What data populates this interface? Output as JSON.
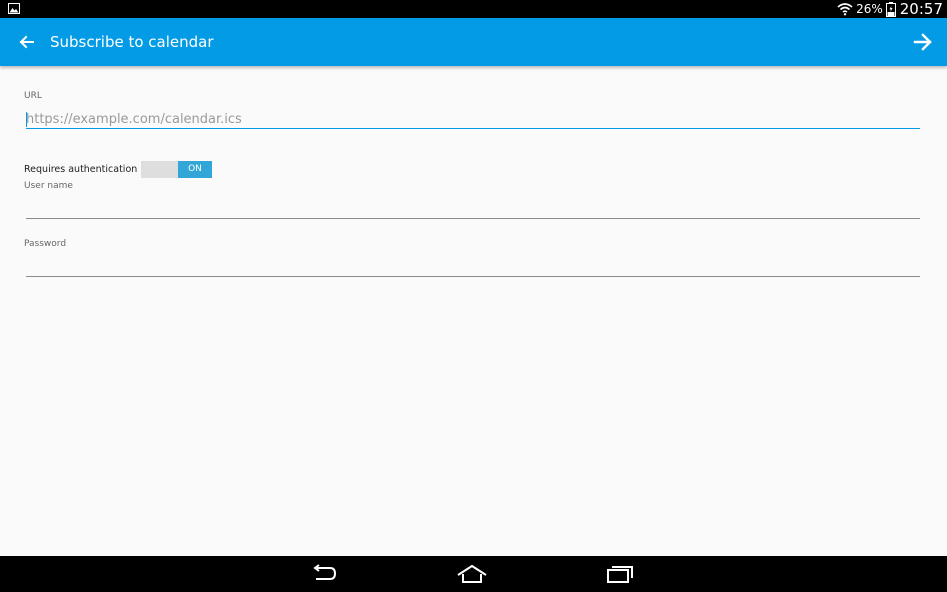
{
  "status_bar": {
    "battery_percent": "26%",
    "time": "20:57",
    "icons": [
      "gallery-icon",
      "wifi-icon",
      "battery-icon"
    ]
  },
  "app_bar": {
    "title": "Subscribe to calendar",
    "color": "#039be5",
    "icons": [
      "back-arrow-icon",
      "forward-arrow-icon"
    ]
  },
  "form": {
    "url": {
      "label": "URL",
      "placeholder": "https://example.com/calendar.ics",
      "value": ""
    },
    "authentication": {
      "label": "Requires authentication",
      "toggle_text": "ON",
      "enabled": true,
      "accent": "#33a6d8"
    },
    "username": {
      "label": "User name",
      "value": ""
    },
    "password": {
      "label": "Password",
      "value": ""
    }
  },
  "nav_bar": {
    "icons": [
      "nav-back-icon",
      "nav-home-icon",
      "nav-recents-icon"
    ]
  }
}
